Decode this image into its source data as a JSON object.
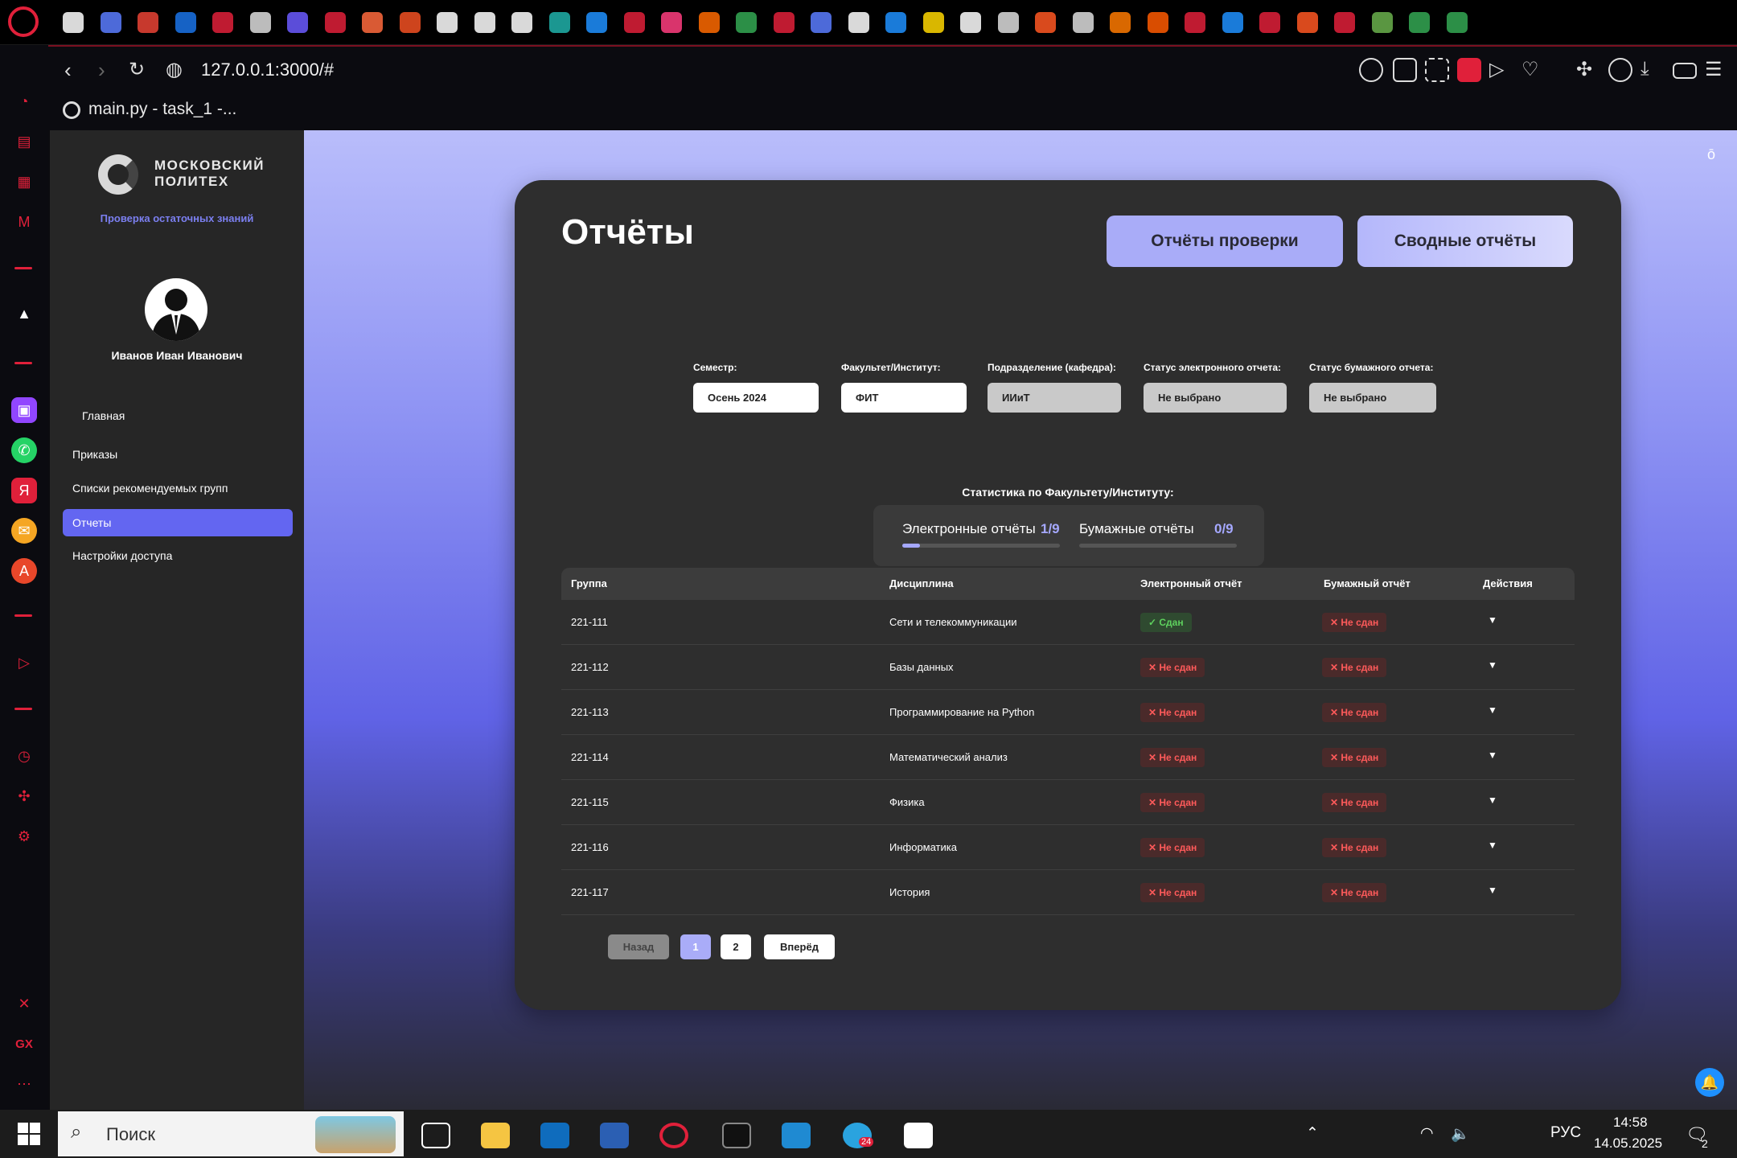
{
  "browser": {
    "url": "127.0.0.1:3000/#",
    "tab_title": "main.py - task_1 -...",
    "accent": "#e0203a"
  },
  "sidebar": {
    "logo_text": "МОСКОВСКИЙ ПОЛИТЕХ",
    "subtitle": "Проверка остаточных знаний",
    "user_name": "Иванов Иван Иванович",
    "items": [
      {
        "label": "Главная",
        "active": false
      },
      {
        "label": "Приказы",
        "active": false
      },
      {
        "label": "Списки рекомендуемых групп",
        "active": false
      },
      {
        "label": "Отчеты",
        "active": true
      },
      {
        "label": "Настройки доступа",
        "active": false
      }
    ]
  },
  "main": {
    "title": "Отчёты",
    "btn_check_reports": "Отчёты проверки",
    "btn_summary_reports": "Сводные отчёты",
    "filters": [
      {
        "label": "Семестр:",
        "value": "Осень 2024"
      },
      {
        "label": "Факультет/Институт:",
        "value": "ФИТ"
      },
      {
        "label": "Подразделение (кафедра):",
        "value": "ИИиТ"
      },
      {
        "label": "Статус электронного отчета:",
        "value": "Не выбрано"
      },
      {
        "label": "Статус бумажного отчета:",
        "value": "Не выбрано"
      }
    ],
    "stats_title": "Статистика по Факультету/Институту:",
    "stats": {
      "electronic_label": "Электронные отчёты",
      "electronic_value": "1/9",
      "electronic_fraction": 0.111,
      "paper_label": "Бумажные отчёты",
      "paper_value": "0/9",
      "paper_fraction": 0
    },
    "table": {
      "headers": [
        "Группа",
        "Дисциплина",
        "Электронный отчёт",
        "Бумажный отчёт",
        "Действия"
      ],
      "rows": [
        {
          "group": "221-111",
          "discipline": "Сети и телекоммуникации",
          "electronic": "✓ Сдан",
          "electronic_ok": true,
          "paper": "✕ Не сдан",
          "paper_ok": false,
          "action": "▼"
        },
        {
          "group": "221-112",
          "discipline": "Базы данных",
          "electronic": "✕ Не сдан",
          "electronic_ok": false,
          "paper": "✕ Не сдан",
          "paper_ok": false,
          "action": "▼"
        },
        {
          "group": "221-113",
          "discipline": "Программирование на Python",
          "electronic": "✕ Не сдан",
          "electronic_ok": false,
          "paper": "✕ Не сдан",
          "paper_ok": false,
          "action": "▼"
        },
        {
          "group": "221-114",
          "discipline": "Математический анализ",
          "electronic": "✕ Не сдан",
          "electronic_ok": false,
          "paper": "✕ Не сдан",
          "paper_ok": false,
          "action": "▼"
        },
        {
          "group": "221-115",
          "discipline": "Физика",
          "electronic": "✕ Не сдан",
          "electronic_ok": false,
          "paper": "✕ Не сдан",
          "paper_ok": false,
          "action": "▼"
        },
        {
          "group": "221-116",
          "discipline": "Информатика",
          "electronic": "✕ Не сдан",
          "electronic_ok": false,
          "paper": "✕ Не сдан",
          "paper_ok": false,
          "action": "▼"
        },
        {
          "group": "221-117",
          "discipline": "История",
          "electronic": "✕ Не сдан",
          "electronic_ok": false,
          "paper": "✕ Не сдан",
          "paper_ok": false,
          "action": "▼"
        }
      ]
    },
    "pagination": {
      "prev": "Назад",
      "pages": [
        "1",
        "2"
      ],
      "current": "1",
      "next": "Вперёд"
    }
  },
  "taskbar": {
    "search_placeholder": "Поиск",
    "lang": "РУС",
    "time": "14:58",
    "date": "14.05.2025",
    "telegram_badge": "24",
    "notif_count": "2"
  }
}
